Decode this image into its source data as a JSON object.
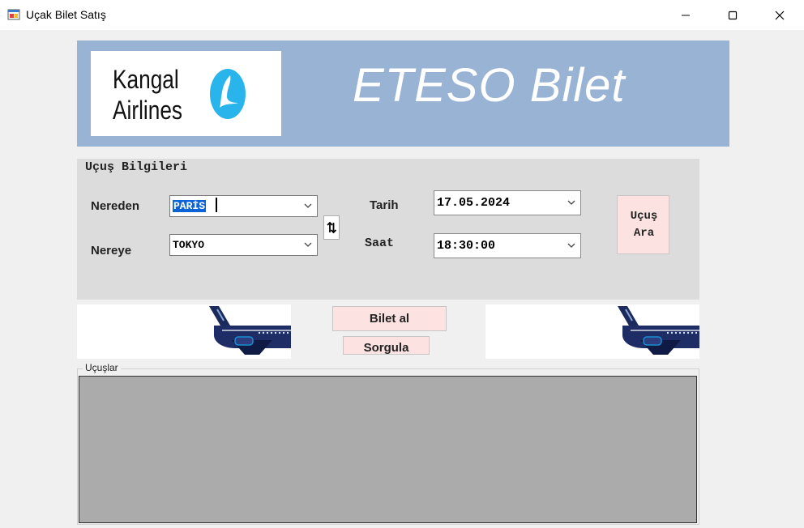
{
  "window": {
    "title": "Uçak Bilet Satış",
    "icons": {
      "app": "app-window-icon",
      "minimize": "minimize-icon",
      "maximize": "maximize-icon",
      "close": "close-icon"
    }
  },
  "header": {
    "logo_line1": "Kangal",
    "logo_line2": "Airlines",
    "brand_title": "ETESO Bilet",
    "colors": {
      "banner": "#98b3d4",
      "logo_mark": "#2ab4ec"
    }
  },
  "flight_info": {
    "title": "Uçuş Bilgileri",
    "from_label": "Nereden",
    "from_value": "PARİS",
    "to_label": "Nereye",
    "to_value": "TOKYO",
    "swap_icon": "swap-vertical-icon",
    "date_label": "Tarih",
    "date_value": "17.05.2024",
    "time_label": "Saat",
    "time_value": "18:30:00",
    "search_button_line1": "Uçuş",
    "search_button_line2": "Ara"
  },
  "actions": {
    "buy_label": "Bilet al",
    "query_label": "Sorgula",
    "button_color": "#fde2e2"
  },
  "flights_group": {
    "label": "Uçuşlar"
  }
}
